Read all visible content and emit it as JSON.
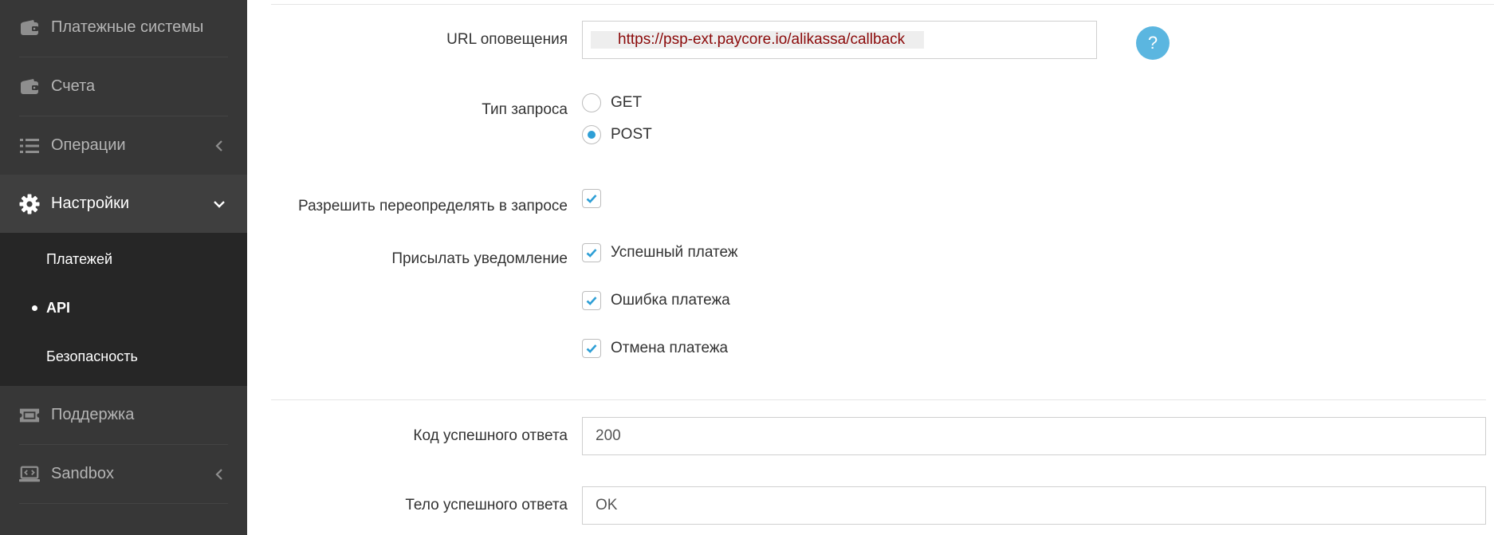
{
  "sidebar": {
    "items": [
      {
        "label": "Платежные системы",
        "icon": "wallet-icon"
      },
      {
        "label": "Счета",
        "icon": "wallet-icon"
      },
      {
        "label": "Операции",
        "icon": "list-icon"
      },
      {
        "label": "Настройки",
        "icon": "gear-icon"
      },
      {
        "label": "Поддержка",
        "icon": "ticket-icon"
      },
      {
        "label": "Sandbox",
        "icon": "laptop-code-icon"
      }
    ],
    "submenu": [
      {
        "label": "Платежей"
      },
      {
        "label": "API"
      },
      {
        "label": "Безопасность"
      }
    ]
  },
  "form": {
    "url": {
      "label": "URL оповещения",
      "value": "https://psp-ext.paycore.io/alikassa/callback",
      "help": "?"
    },
    "request_type": {
      "label": "Тип запроса",
      "options": [
        "GET",
        "POST"
      ],
      "selected": "POST"
    },
    "override": {
      "label": "Разрешить переопределять в запросе",
      "checked": true
    },
    "notify": {
      "label": "Присылать уведомление",
      "options": [
        {
          "label": "Успешный платеж",
          "checked": true
        },
        {
          "label": "Ошибка платежа",
          "checked": true
        },
        {
          "label": "Отмена платежа",
          "checked": true
        }
      ]
    },
    "success_code": {
      "label": "Код успешного ответа",
      "value": "200"
    },
    "success_body": {
      "label": "Тело успешного ответа",
      "value": "OK"
    }
  },
  "colors": {
    "sidebar_bg": "#373737",
    "submenu_bg": "#262626",
    "accent": "#2e9fd6",
    "help_bg": "#5bb6e0",
    "url_text": "#8b0a0a"
  }
}
